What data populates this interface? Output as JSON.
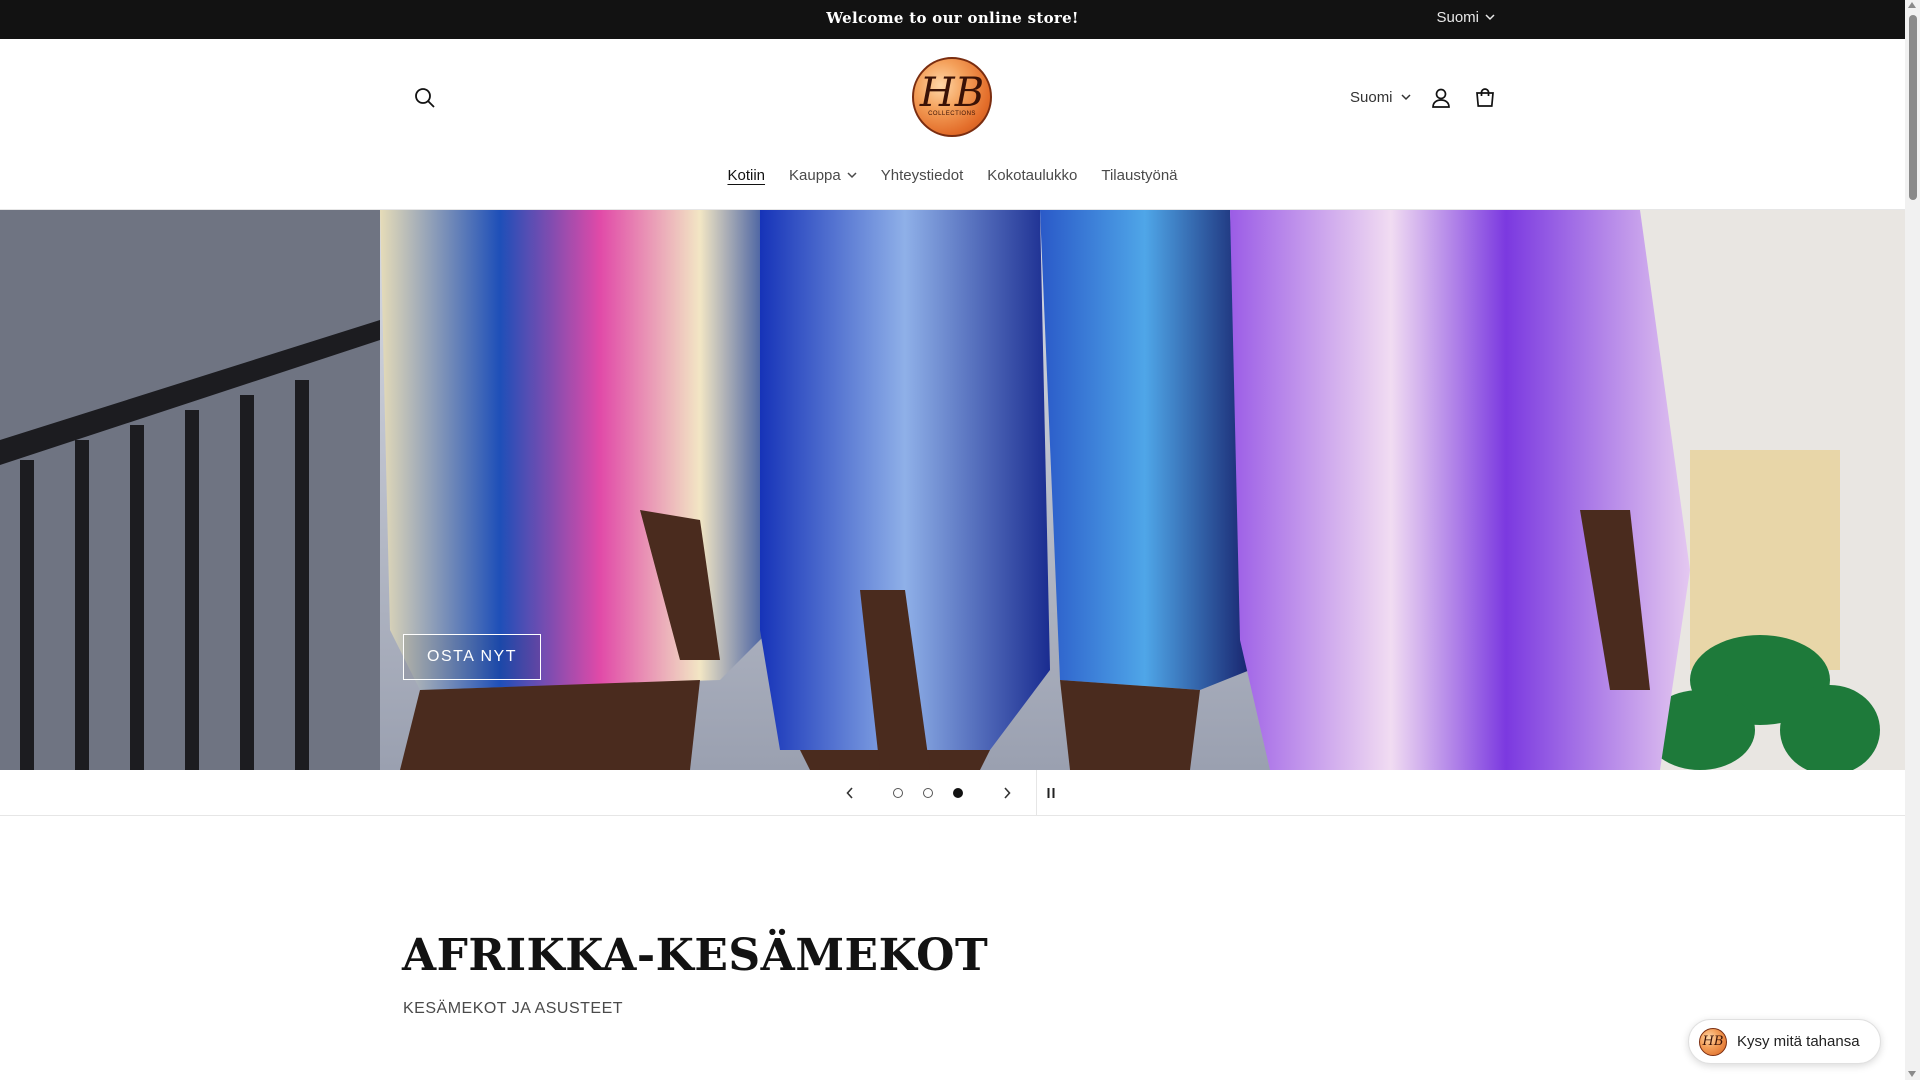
{
  "announcement": {
    "message": "Welcome to our online store!",
    "language": "Suomi"
  },
  "header": {
    "logo_text": "HB",
    "logo_subtext": "COLLECTIONS",
    "language": "Suomi"
  },
  "nav": {
    "items": [
      {
        "label": "Kotiin",
        "active": true
      },
      {
        "label": "Kauppa",
        "has_dropdown": true
      },
      {
        "label": "Yhteystiedot"
      },
      {
        "label": "Kokotaulukko"
      },
      {
        "label": "Tilaustyönä"
      }
    ]
  },
  "hero": {
    "cta_label": "OSTA NYT",
    "slides_count": 3,
    "active_slide": 3
  },
  "collection": {
    "title": "AFRIKKA-KESÄMEKOT",
    "subtitle": "KESÄMEKOT JA ASUSTEET"
  },
  "chat": {
    "label": "Kysy mitä tahansa",
    "avatar_text": "HB"
  },
  "icons": {
    "search": "search-icon",
    "account": "account-icon",
    "cart": "cart-icon",
    "prev": "chevron-left-icon",
    "next": "chevron-right-icon",
    "pause": "pause-icon"
  }
}
